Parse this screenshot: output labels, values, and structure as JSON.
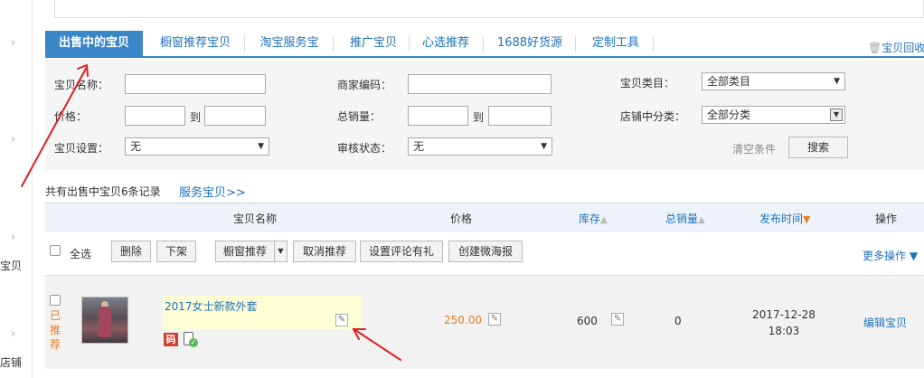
{
  "leftnav": {
    "cut_labels": [
      "宝贝",
      "店铺"
    ]
  },
  "tabs": [
    {
      "label": "出售中的宝贝",
      "active": true
    },
    {
      "label": "橱窗推荐宝贝"
    },
    {
      "label": "淘宝服务宝"
    },
    {
      "label": "推广宝贝"
    },
    {
      "label": "心选推荐"
    },
    {
      "label": "1688好货源"
    },
    {
      "label": "定制工具"
    }
  ],
  "recycle_label": "宝贝回收",
  "filters": {
    "item_name_label": "宝贝名称：",
    "merchant_code_label": "商家编码：",
    "category_label": "宝贝类目：",
    "category_value": "全部类目",
    "price_label": "价格：",
    "to_label": "到",
    "total_sales_label": "总销量：",
    "shop_category_label": "店铺中分类：",
    "shop_category_value": "全部分类",
    "item_setting_label": "宝贝设置：",
    "item_setting_value": "无",
    "review_status_label": "审核状态：",
    "review_status_value": "无",
    "clear_label": "清空条件",
    "search_label": "搜索"
  },
  "summary": "共有出售中宝贝6条记录",
  "service_link": "服务宝贝>>",
  "table_header": {
    "name": "宝贝名称",
    "price": "价格",
    "stock": "库存",
    "total_sales": "总销量",
    "publish_time": "发布时间",
    "operation": "操作"
  },
  "actions": {
    "select_all": "全选",
    "delete": "删除",
    "delist": "下架",
    "window_recommend": "橱窗推荐",
    "cancel_recommend": "取消推荐",
    "review_gift": "设置评论有礼",
    "create_weitao": "创建微海报",
    "more": "更多操作"
  },
  "product": {
    "status": "已推荐",
    "title": "2017女士新款外套",
    "badge": "码",
    "price": "250.00",
    "stock": "600",
    "sales": "0",
    "publish_date": "2017-12-28",
    "publish_time": "18:03",
    "edit_link": "编辑宝贝"
  },
  "colors": {
    "accent": "#3a87c8",
    "link": "#1e72bd",
    "price": "#e67e22",
    "annotation": "#e02020"
  }
}
